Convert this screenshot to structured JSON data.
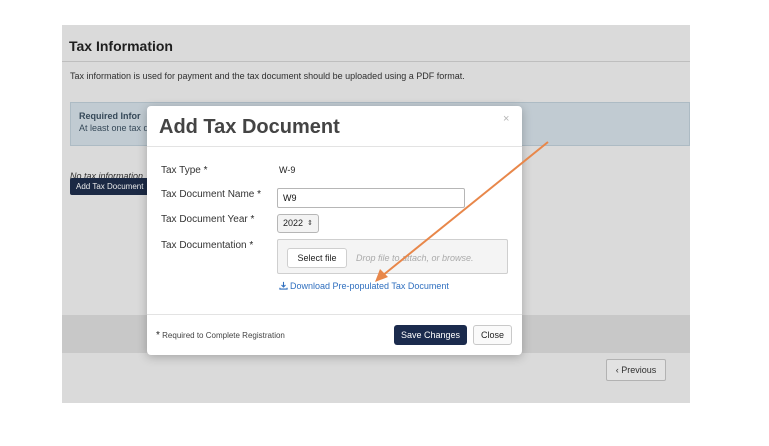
{
  "page": {
    "title": "Tax Information",
    "description": "Tax information is used for payment and the tax document should be uploaded using a PDF format.",
    "alert_title": "Required Infor",
    "alert_text": "At least one tax d",
    "no_info_text": "No tax information",
    "add_button_label": "Add Tax Document",
    "previous_button_label": "‹ Previous"
  },
  "modal": {
    "title": "Add Tax Document",
    "close_glyph": "×",
    "required_mark": "*",
    "fields": {
      "tax_type_label": "Tax Type",
      "tax_type_value": "W-9",
      "doc_name_label": "Tax Document Name",
      "doc_name_value": "W9",
      "doc_year_label": "Tax Document Year",
      "doc_year_value": "2022",
      "documentation_label": "Tax Documentation"
    },
    "dropzone": {
      "select_file_label": "Select file",
      "hint": "Drop file to attach, or browse."
    },
    "download_link": "Download Pre-populated Tax Document",
    "footer": {
      "required_note": "Required to Complete Registration",
      "save_label": "Save Changes",
      "close_label": "Close"
    }
  },
  "colors": {
    "primary_button": "#1b2b4d",
    "link": "#2f6fbf",
    "annotation_arrow": "#e8874a"
  },
  "icons": {
    "select_arrows": "⇕",
    "download": "download-icon"
  }
}
